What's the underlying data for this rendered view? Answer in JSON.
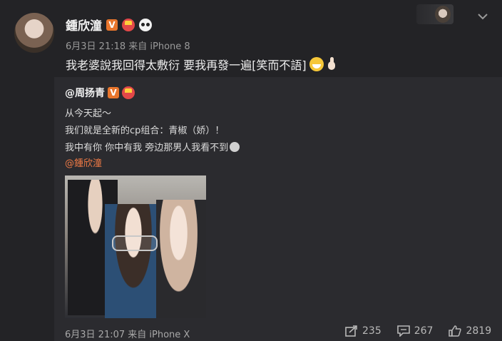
{
  "post": {
    "author": "鍾欣潼",
    "verified_badge": "V",
    "time": "6月3日 21:18",
    "source": "来自 iPhone 8",
    "text": "我老婆說我回得太敷衍 要我再發一遍[笑而不語]"
  },
  "repost": {
    "author": "@周扬青",
    "verified_badge": "V",
    "lines": [
      "从今天起～",
      "我们就是全新的cp组合：青椒（娇）！",
      "我中有你 你中有我 旁边那男人我看不到"
    ],
    "mention": "@鍾欣潼",
    "time": "6月3日 21:07",
    "source": "来自 iPhone X"
  },
  "actions": {
    "repost_count": "235",
    "comment_count": "267",
    "like_count": "2819"
  },
  "colors": {
    "background": "#232326",
    "repost_background": "#2b2b2f",
    "mention": "#ef7a45",
    "verified": "#e8752c"
  }
}
